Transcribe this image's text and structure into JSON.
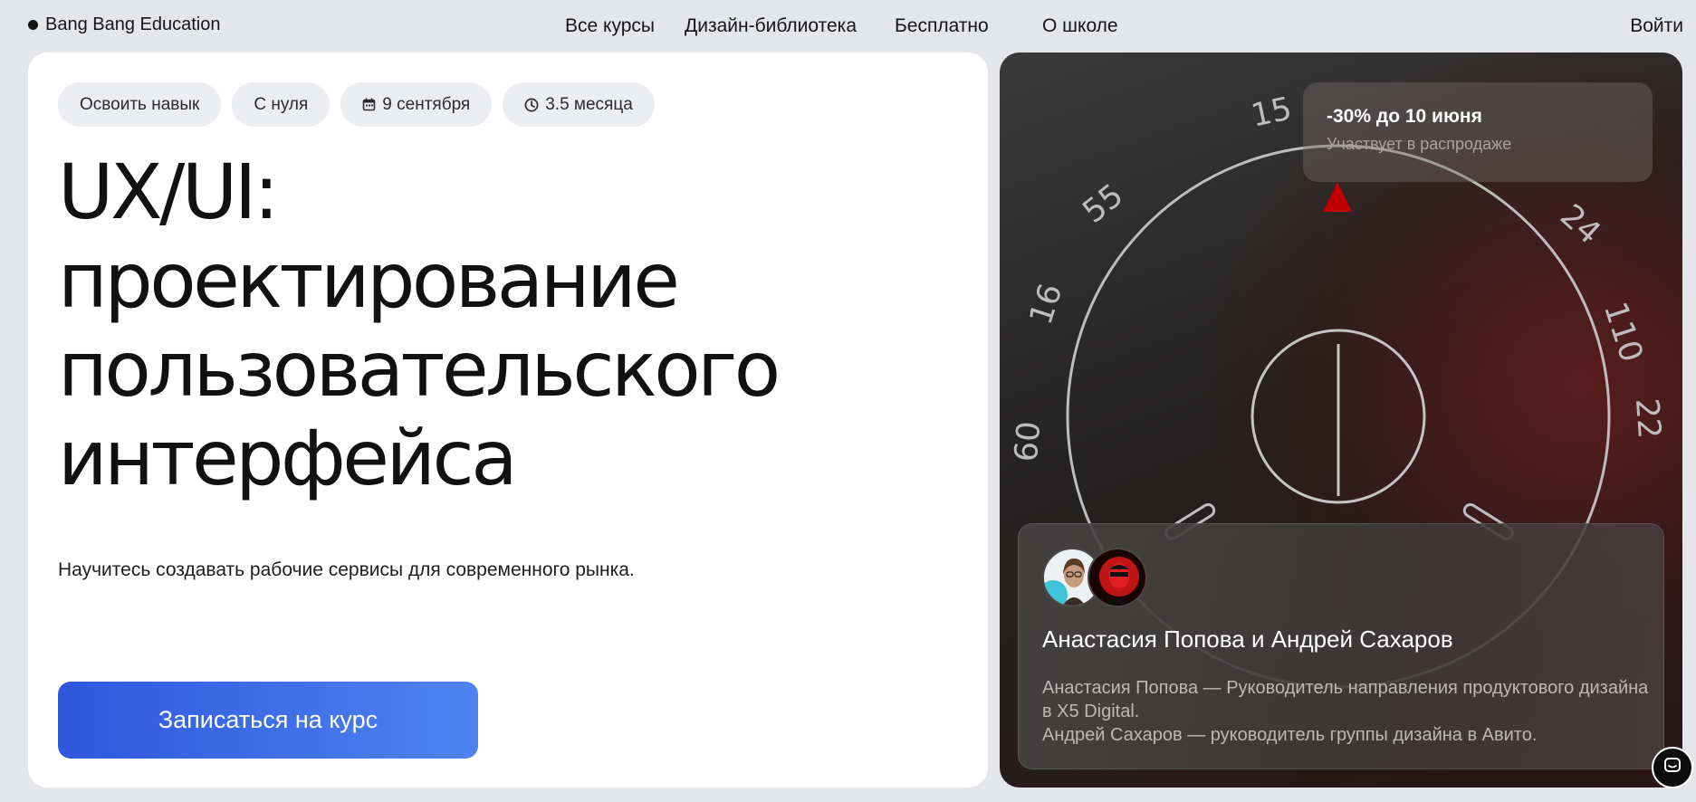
{
  "header": {
    "logo_text": "Bang Bang Education",
    "nav": {
      "courses": "Все курсы",
      "library": "Дизайн-библиотека",
      "free": "Бесплатно",
      "about": "О школе",
      "login": "Войти"
    }
  },
  "course": {
    "tags": {
      "goal": "Освоить навык",
      "level": "С нуля",
      "start_date": "9 сентября",
      "duration": "3.5 месяца"
    },
    "title_lines": {
      "l1": "UX/UI:",
      "l2": "проектирование",
      "l3": "пользовательского",
      "l4": "интерфейса"
    },
    "subtitle": "Научитесь создавать рабочие сервисы для современного рынка.",
    "enroll_label": "Записаться на курс"
  },
  "promo": {
    "sale_title": "-30% до 10 июня",
    "sale_subtitle": "Участвует в распродаже",
    "dial_numbers": [
      "15",
      "55",
      "24",
      "16",
      "110",
      "60",
      "22"
    ]
  },
  "authors": {
    "names": "Анастасия Попова и Андрей Сахаров",
    "bio_1": "Анастасия Попова — Руководитель направления продуктового дизайна в X5 Digital.",
    "bio_2": "Андрей Сахаров — руководитель группы дизайна в Авито."
  },
  "colors": {
    "accent_start": "#2e58dd",
    "accent_end": "#4f83f1",
    "dial_marker": "#c00000"
  }
}
